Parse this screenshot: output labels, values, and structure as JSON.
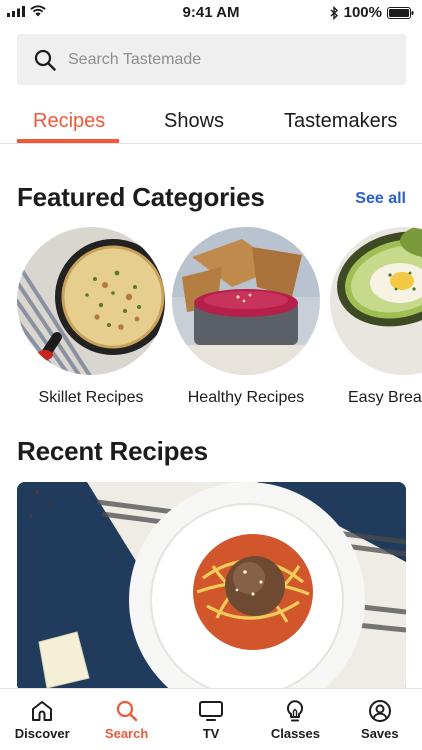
{
  "status": {
    "time": "9:41 AM",
    "battery": "100%"
  },
  "search": {
    "placeholder": "Search Tastemade"
  },
  "tabs": [
    {
      "label": "Recipes",
      "active": true
    },
    {
      "label": "Shows",
      "active": false
    },
    {
      "label": "Tastemakers",
      "active": false
    }
  ],
  "featured": {
    "title": "Featured Categories",
    "see_all": "See all",
    "categories": [
      {
        "label": "Skillet Recipes"
      },
      {
        "label": "Healthy Recipes"
      },
      {
        "label": "Easy Breakfast"
      }
    ]
  },
  "recent": {
    "title": "Recent Recipes"
  },
  "nav": [
    {
      "label": "Discover",
      "icon": "home-icon",
      "active": false
    },
    {
      "label": "Search",
      "icon": "search-icon",
      "active": true
    },
    {
      "label": "TV",
      "icon": "tv-icon",
      "active": false
    },
    {
      "label": "Classes",
      "icon": "lightbulb-icon",
      "active": false
    },
    {
      "label": "Saves",
      "icon": "profile-icon",
      "active": false
    }
  ],
  "colors": {
    "accent": "#f0583a",
    "link": "#2a5fd0"
  }
}
